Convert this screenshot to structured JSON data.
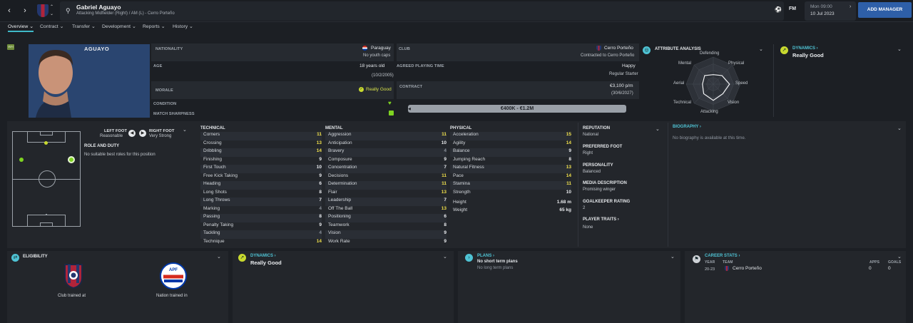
{
  "topbar": {
    "player_name": "Gabriel Aguayo",
    "subtitle": "Attacking Midfielder (Right) / AM (L) - Cerro Porteño",
    "date_line1": "Mon 09:00",
    "date_line2": "10 Jul 2023",
    "add_manager": "ADD MANAGER",
    "fm_label": "FM"
  },
  "tabs": [
    "Overview",
    "Contract",
    "Transfer",
    "Development",
    "Reports",
    "History"
  ],
  "profile": {
    "surname": "AGUAYO",
    "badge": "WH",
    "nationality_label": "NATIONALITY",
    "nationality": "Paraguay",
    "youth_caps": "No youth caps",
    "age_label": "AGE",
    "age": "18 years old",
    "dob": "(10/2/2005)",
    "morale_label": "MORALE",
    "morale": "Really Good",
    "condition_label": "CONDITION",
    "sharpness_label": "MATCH SHARPNESS",
    "club_label": "CLUB",
    "club": "Cerro Porteño",
    "club_contract": "Contracted to Cerro Porteño",
    "apt_label": "AGREED PLAYING TIME",
    "happiness": "Happy",
    "playing_time": "Regular Starter",
    "contract_label": "CONTRACT",
    "wage": "€3,100 p/m",
    "expiry": "(30/6/2027)",
    "value": "€400K - €1.2M"
  },
  "attr_analysis": {
    "title": "ATTRIBUTE ANALYSIS",
    "axes": [
      "Defending",
      "Physical",
      "Speed",
      "Vision",
      "Attacking",
      "Technical",
      "Aerial",
      "Mental"
    ],
    "levels": [
      0.35,
      0.45,
      0.6,
      0.5,
      0.6,
      0.5,
      0.4,
      0.45
    ]
  },
  "dynamics_top": {
    "title": "DYNAMICS",
    "value": "Really Good"
  },
  "feet": {
    "left_label": "LEFT FOOT",
    "left": "Reasonable",
    "right_label": "RIGHT FOOT",
    "right": "Very Strong",
    "role_title": "ROLE AND DUTY",
    "role_text": "No suitable best roles for this position"
  },
  "technical": {
    "title": "TECHNICAL",
    "rows": [
      [
        "Corners",
        "11",
        "y"
      ],
      [
        "Crossing",
        "13",
        "y"
      ],
      [
        "Dribbling",
        "14",
        "y"
      ],
      [
        "Finishing",
        "9",
        "w"
      ],
      [
        "First Touch",
        "10",
        "w"
      ],
      [
        "Free Kick Taking",
        "9",
        "w"
      ],
      [
        "Heading",
        "6",
        "w"
      ],
      [
        "Long Shots",
        "8",
        "w"
      ],
      [
        "Long Throws",
        "7",
        "w"
      ],
      [
        "Marking",
        "4",
        "g"
      ],
      [
        "Passing",
        "8",
        "w"
      ],
      [
        "Penalty Taking",
        "9",
        "w"
      ],
      [
        "Tackling",
        "4",
        "g"
      ],
      [
        "Technique",
        "14",
        "y"
      ]
    ]
  },
  "mental": {
    "title": "MENTAL",
    "rows": [
      [
        "Aggression",
        "11",
        "y"
      ],
      [
        "Anticipation",
        "10",
        "w"
      ],
      [
        "Bravery",
        "4",
        "g"
      ],
      [
        "Composure",
        "9",
        "w"
      ],
      [
        "Concentration",
        "7",
        "w"
      ],
      [
        "Decisions",
        "11",
        "y"
      ],
      [
        "Determination",
        "11",
        "y"
      ],
      [
        "Flair",
        "13",
        "y"
      ],
      [
        "Leadership",
        "7",
        "w"
      ],
      [
        "Off The Ball",
        "13",
        "y"
      ],
      [
        "Positioning",
        "6",
        "w"
      ],
      [
        "Teamwork",
        "8",
        "w"
      ],
      [
        "Vision",
        "9",
        "w"
      ],
      [
        "Work Rate",
        "9",
        "w"
      ]
    ]
  },
  "physical": {
    "title": "PHYSICAL",
    "rows": [
      [
        "Acceleration",
        "15",
        "y"
      ],
      [
        "Agility",
        "14",
        "y"
      ],
      [
        "Balance",
        "9",
        "w"
      ],
      [
        "Jumping Reach",
        "8",
        "w"
      ],
      [
        "Natural Fitness",
        "13",
        "y"
      ],
      [
        "Pace",
        "14",
        "y"
      ],
      [
        "Stamina",
        "11",
        "y"
      ],
      [
        "Strength",
        "10",
        "w"
      ]
    ],
    "height_label": "Height",
    "height": "1.68 m",
    "weight_label": "Weight",
    "weight": "65 kg"
  },
  "info": {
    "reputation_label": "REPUTATION",
    "reputation": "National",
    "pref_foot_label": "PREFERRED FOOT",
    "pref_foot": "Right",
    "personality_label": "PERSONALITY",
    "personality": "Balanced",
    "media_label": "MEDIA DESCRIPTION",
    "media": "Promising winger",
    "gk_label": "GOALKEEPER RATING",
    "gk": "2",
    "traits_label": "PLAYER TRAITS",
    "traits": "None"
  },
  "biography": {
    "title": "BIOGRAPHY",
    "text": "No biography is available at this time."
  },
  "eligibility": {
    "title": "ELIGIBILITY",
    "club_trained": "Club trained at",
    "nation_trained": "Nation trained in"
  },
  "dynamics_bottom": {
    "title": "DYNAMICS",
    "value": "Really Good"
  },
  "plans": {
    "title": "PLANS",
    "short": "No short term plans",
    "long": "No long term plans"
  },
  "career": {
    "title": "CAREER STATS",
    "col_year": "YEAR",
    "col_team": "TEAM",
    "col_apps": "APPS",
    "col_goals": "GOALS",
    "year": "20-23",
    "team": "Cerro Porteño",
    "apps": "0",
    "goals": "0"
  },
  "colors": {
    "accent": "#4fc3d4",
    "highlight": "#f0e04a",
    "positive": "#7ed321"
  }
}
